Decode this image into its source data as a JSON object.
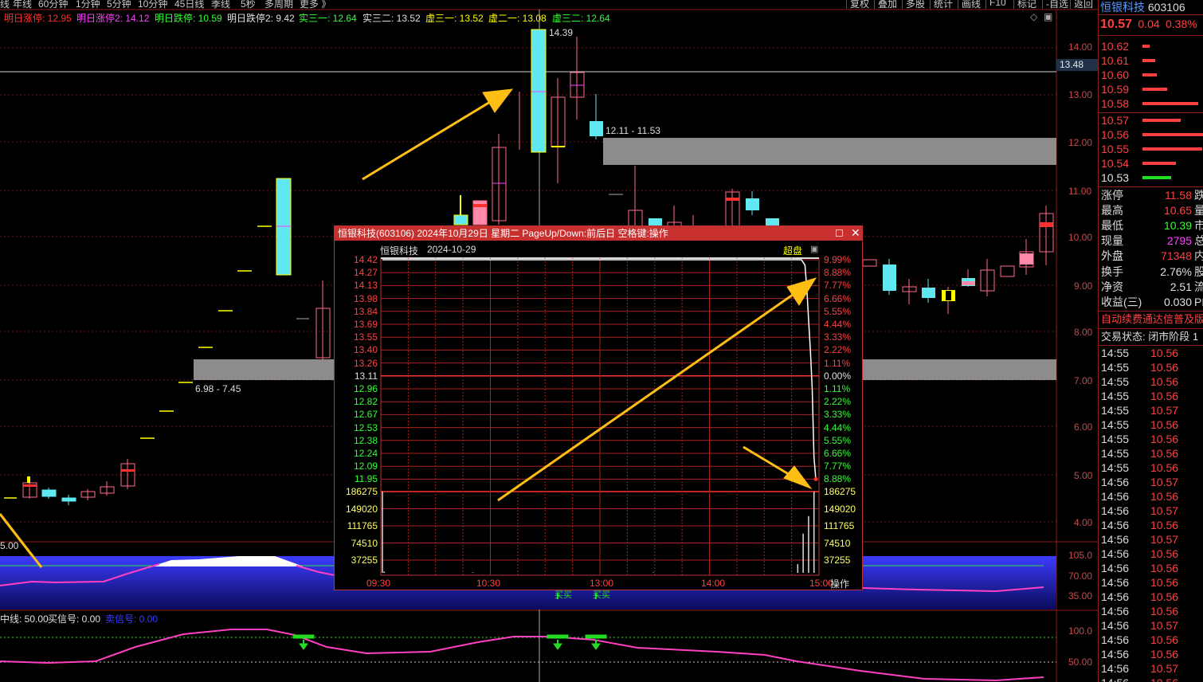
{
  "topbar": {
    "tabs": [
      "线",
      "年线",
      "60分钟",
      "1分钟",
      "5分钟",
      "10分钟",
      "45日线",
      "季线",
      "5秒",
      "多周期",
      "更多 》"
    ],
    "right_buttons": [
      "复权",
      "叠加",
      "多股",
      "统计",
      "画线",
      "F10",
      "标记",
      "-自选",
      "返回"
    ]
  },
  "indicators": [
    {
      "label": "明日涨停: ",
      "value": "12.95",
      "color": "#ff3030"
    },
    {
      "label": "明日涨停2: ",
      "value": "14.12",
      "color": "#ff40ff"
    },
    {
      "label": "明日跌停: ",
      "value": "10.59",
      "color": "#33ff33"
    },
    {
      "label": "明日跌停2: ",
      "value": "9.42",
      "color": "#e0e0e0"
    },
    {
      "label": "实三一: ",
      "value": "12.64",
      "color": "#33ff33"
    },
    {
      "label": "实三二: ",
      "value": "13.52",
      "color": "#e0e0e0"
    },
    {
      "label": "虚三一: ",
      "value": "13.52",
      "color": "#ffff00"
    },
    {
      "label": "虚二一: ",
      "value": "13.08",
      "color": "#ffff00"
    },
    {
      "label": "虚三二: ",
      "value": "12.64",
      "color": "#33ff33"
    }
  ],
  "main_chart": {
    "y_axis": [
      "14.00",
      "13.00",
      "12.00",
      "11.00",
      "10.00",
      "9.00",
      "8.00",
      "7.00",
      "6.00",
      "5.00",
      "4.00"
    ],
    "current_price_box": "13.48",
    "high_label": "14.39",
    "zone_upper_label": "12.11 - 11.53",
    "zone_lower_label": "6.98 - 7.45"
  },
  "sub_chart1": {
    "y_axis": [
      "105.0",
      "70.00",
      "35.00"
    ],
    "left_value": "5.00",
    "buy_label": "买买"
  },
  "sub_chart2": {
    "legend": [
      {
        "text": "中线: 50.00",
        "color": "#e0e0e0"
      },
      {
        "text": "买信号: 0.00",
        "color": "#e0e0e0"
      },
      {
        "text": "卖信号: 0.00",
        "color": "#3a3aff"
      }
    ],
    "y_axis": [
      "100.0",
      "50.00"
    ]
  },
  "stock_panel": {
    "name": "恒银科技",
    "code": "603106",
    "price": "10.57",
    "change": "0.04",
    "change_pct": "0.38%",
    "order_book": [
      {
        "price": "10.62",
        "bar": 0.07
      },
      {
        "price": "10.61",
        "bar": 0.12
      },
      {
        "price": "10.60",
        "bar": 0.14
      },
      {
        "price": "10.59",
        "bar": 0.24
      },
      {
        "price": "10.58",
        "bar": 0.54
      },
      {
        "price": "10.57",
        "bar": 0.37
      },
      {
        "price": "10.56",
        "bar": 0.62
      },
      {
        "price": "10.55",
        "bar": 0.58
      },
      {
        "price": "10.54",
        "bar": 0.32
      },
      {
        "price": "10.53",
        "bar": 0.28
      }
    ],
    "stats": [
      {
        "label": "涨停",
        "value": "11.58",
        "tail": "跌",
        "vcolor": "#ff4040"
      },
      {
        "label": "最高",
        "value": "10.65",
        "tail": "量",
        "vcolor": "#ff4040"
      },
      {
        "label": "最低",
        "value": "10.39",
        "tail": "市",
        "vcolor": "#33ff33"
      },
      {
        "label": "现量",
        "value": "2795",
        "tail": "总",
        "vcolor": "#ff40ff"
      },
      {
        "label": "外盘",
        "value": "71348",
        "tail": "内",
        "vcolor": "#ff4040"
      },
      {
        "label": "换手",
        "value": "2.76%",
        "tail": "股",
        "vcolor": "#e0e0e0"
      },
      {
        "label": "净资",
        "value": "2.51",
        "tail": "流",
        "vcolor": "#e0e0e0"
      },
      {
        "label": "收益(三)",
        "value": "0.030",
        "tail": "PE",
        "vcolor": "#e0e0e0"
      }
    ],
    "ad_text": "自动续费通达信普及版",
    "trade_status": "交易状态: 闭市阶段 1",
    "ticks": [
      {
        "time": "14:55",
        "price": "10.56"
      },
      {
        "time": "14:55",
        "price": "10.56"
      },
      {
        "time": "14:55",
        "price": "10.56"
      },
      {
        "time": "14:55",
        "price": "10.56"
      },
      {
        "time": "14:55",
        "price": "10.57"
      },
      {
        "time": "14:55",
        "price": "10.56"
      },
      {
        "time": "14:55",
        "price": "10.56"
      },
      {
        "time": "14:55",
        "price": "10.56"
      },
      {
        "time": "14:55",
        "price": "10.56"
      },
      {
        "time": "14:56",
        "price": "10.57"
      },
      {
        "time": "14:56",
        "price": "10.56"
      },
      {
        "time": "14:56",
        "price": "10.57"
      },
      {
        "time": "14:56",
        "price": "10.56"
      },
      {
        "time": "14:56",
        "price": "10.57"
      },
      {
        "time": "14:56",
        "price": "10.56"
      },
      {
        "time": "14:56",
        "price": "10.56"
      },
      {
        "time": "14:56",
        "price": "10.56"
      },
      {
        "time": "14:56",
        "price": "10.56"
      },
      {
        "time": "14:56",
        "price": "10.56"
      },
      {
        "time": "14:56",
        "price": "10.57"
      },
      {
        "time": "14:56",
        "price": "10.56"
      },
      {
        "time": "14:56",
        "price": "10.56"
      },
      {
        "time": "14:56",
        "price": "10.57"
      },
      {
        "time": "14:56",
        "price": "10.56"
      }
    ]
  },
  "popup": {
    "title": "恒银科技(603106) 2024年10月29日 星期二 PageUp/Down:前后日 空格键:操作",
    "stock_name": "恒银科技",
    "date": "2024-10-29",
    "super_label": "超盘",
    "price_axis": [
      "14.42",
      "14.27",
      "14.13",
      "13.98",
      "13.84",
      "13.69",
      "13.55",
      "13.40",
      "13.26",
      "13.11",
      "12.96",
      "12.82",
      "12.67",
      "12.53",
      "12.38",
      "12.24",
      "12.09",
      "11.95"
    ],
    "pct_axis": [
      "9.99%",
      "8.88%",
      "7.77%",
      "6.66%",
      "5.55%",
      "4.44%",
      "3.33%",
      "2.22%",
      "1.11%",
      "0.00%",
      "1.11%",
      "2.22%",
      "3.33%",
      "4.44%",
      "5.55%",
      "6.66%",
      "7.77%",
      "8.88%"
    ],
    "vol_axis": [
      "186275",
      "149020",
      "111765",
      "74510",
      "37255"
    ],
    "time_axis": [
      "09:30",
      "10:30",
      "13:00",
      "14:00",
      "15:00"
    ],
    "op_label": "操作",
    "intraday_series": [
      {
        "t": 0,
        "price": 14.42
      },
      {
        "t": 1,
        "price": 14.42
      },
      {
        "t": 200,
        "price": 14.42
      },
      {
        "t": 232,
        "price": 14.42
      },
      {
        "t": 234,
        "price": 14.36
      },
      {
        "t": 235,
        "price": 14.1
      },
      {
        "t": 236,
        "price": 13.75
      },
      {
        "t": 237,
        "price": 13.4
      },
      {
        "t": 238,
        "price": 12.96
      },
      {
        "t": 239,
        "price": 12.2
      },
      {
        "t": 240,
        "price": 11.95
      }
    ],
    "volume_series": [
      {
        "t": 0,
        "v": 186275
      },
      {
        "t": 1,
        "v": 3000
      },
      {
        "t": 50,
        "v": 1200
      },
      {
        "t": 150,
        "v": 1000
      },
      {
        "t": 230,
        "v": 20000
      },
      {
        "t": 233,
        "v": 90000
      },
      {
        "t": 236,
        "v": 130000
      },
      {
        "t": 239,
        "v": 186275
      }
    ]
  }
}
